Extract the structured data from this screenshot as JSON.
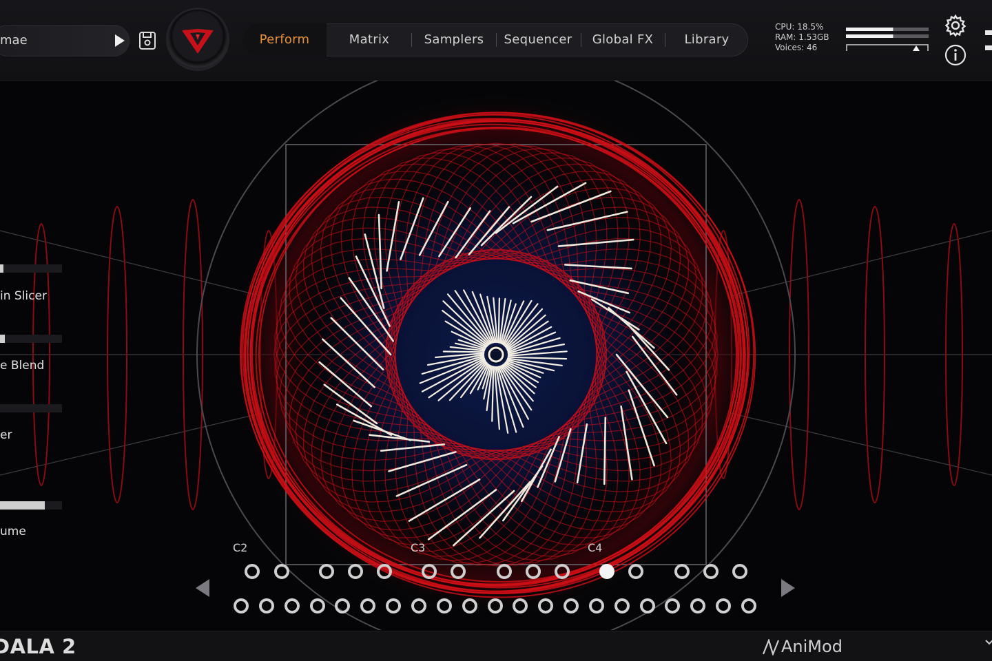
{
  "header": {
    "preset_name": "mae",
    "tabs": [
      {
        "label": "Perform",
        "active": true
      },
      {
        "label": "Matrix",
        "active": false
      },
      {
        "label": "Samplers",
        "active": false
      },
      {
        "label": "Sequencer",
        "active": false
      },
      {
        "label": "Global FX",
        "active": false
      },
      {
        "label": "Library",
        "active": false
      }
    ],
    "stats": {
      "cpu": "CPU: 18.5%",
      "ram": "RAM: 1.53GB",
      "voices": "Voices: 46"
    },
    "meter": {
      "level_top": 0.57,
      "level_bottom": 0.57,
      "marker": 0.85
    }
  },
  "params": [
    {
      "label": "in Slicer",
      "value": 0.05
    },
    {
      "label": "e Blend",
      "value": 0.08
    },
    {
      "label": "er",
      "value": 0.0
    },
    {
      "label": "ume",
      "value": 0.72
    }
  ],
  "keyboard": {
    "note_labels": [
      "C2",
      "C3",
      "C4"
    ],
    "active_key": "top-row-10"
  },
  "footer": {
    "product": "DALA 2",
    "maker": "AniMod"
  },
  "colors": {
    "accent": "#e8913a",
    "viz_red": "#d10f17",
    "background": "#050507"
  }
}
